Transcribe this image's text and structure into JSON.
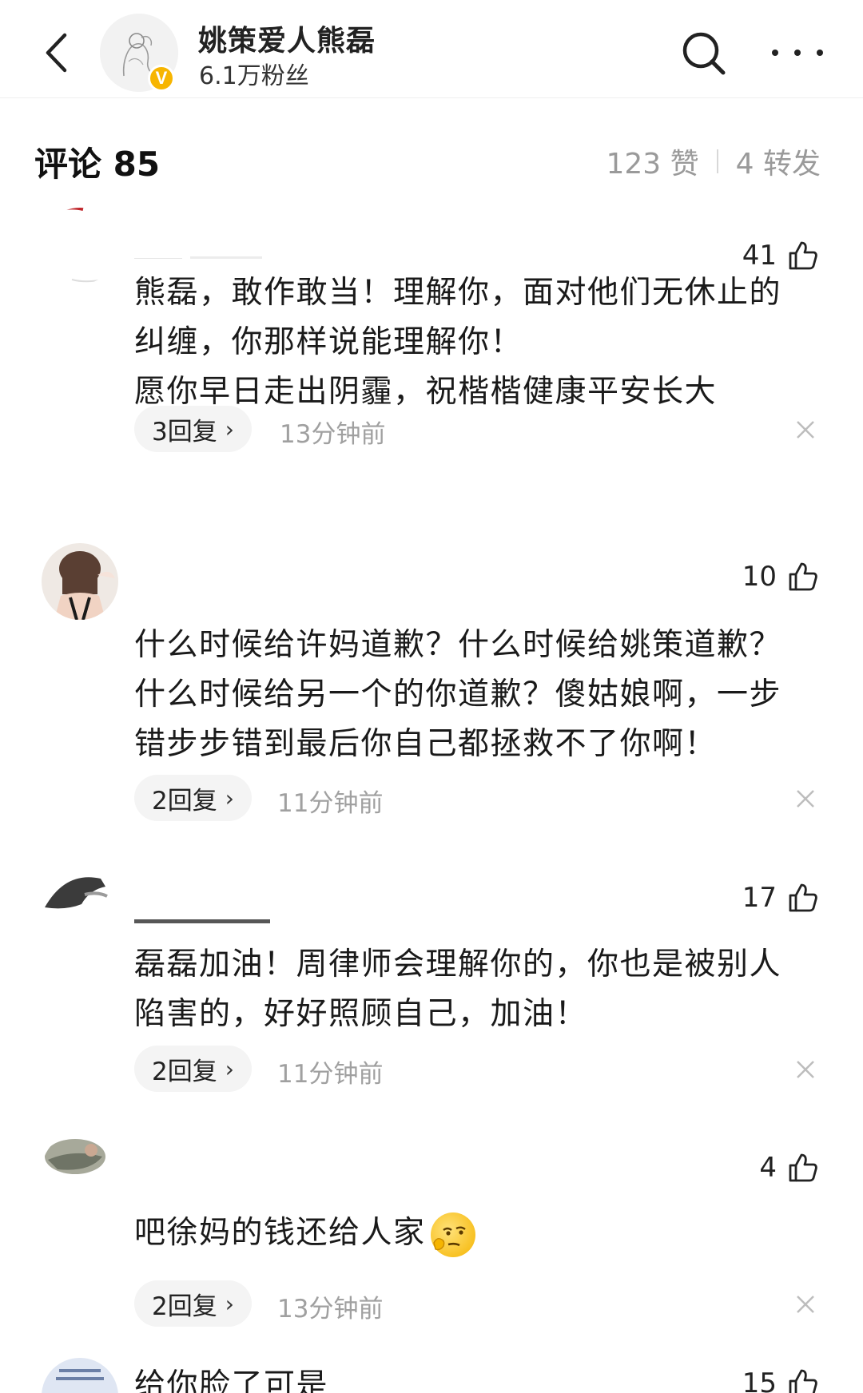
{
  "header": {
    "name": "姚策爱人熊磊",
    "fans": "6.1万粉丝",
    "verified_badge": "V",
    "accent": "#f7b500"
  },
  "stats": {
    "comments_label": "评论 85",
    "likes_label": "123 赞",
    "reposts_label": "4 转发"
  },
  "comments": [
    {
      "likes": "41",
      "lines": [
        "熊磊，敢作敢当！理解你，面对他们无休止的",
        "纠缠，你那样说能理解你！",
        "愿你早日走出阴霾，祝楷楷健康平安长大"
      ],
      "replies": "3回复",
      "time": "13分钟前"
    },
    {
      "likes": "10",
      "lines": [
        "什么时候给许妈道歉？什么时候给姚策道歉？",
        "什么时候给另一个的你道歉？傻姑娘啊，一步",
        "错步步错到最后你自己都拯救不了你啊！"
      ],
      "replies": "2回复",
      "time": "11分钟前"
    },
    {
      "likes": "17",
      "lines": [
        "磊磊加油！周律师会理解你的，你也是被别人",
        "陷害的，好好照顾自己，加油！"
      ],
      "replies": "2回复",
      "time": "11分钟前"
    },
    {
      "likes": "4",
      "lines": [
        "吧徐妈的钱还给人家"
      ],
      "replies": "2回复",
      "time": "13分钟前"
    },
    {
      "likes": "15",
      "lines": [
        "给你脸了可是"
      ],
      "replies": "",
      "time": ""
    }
  ]
}
